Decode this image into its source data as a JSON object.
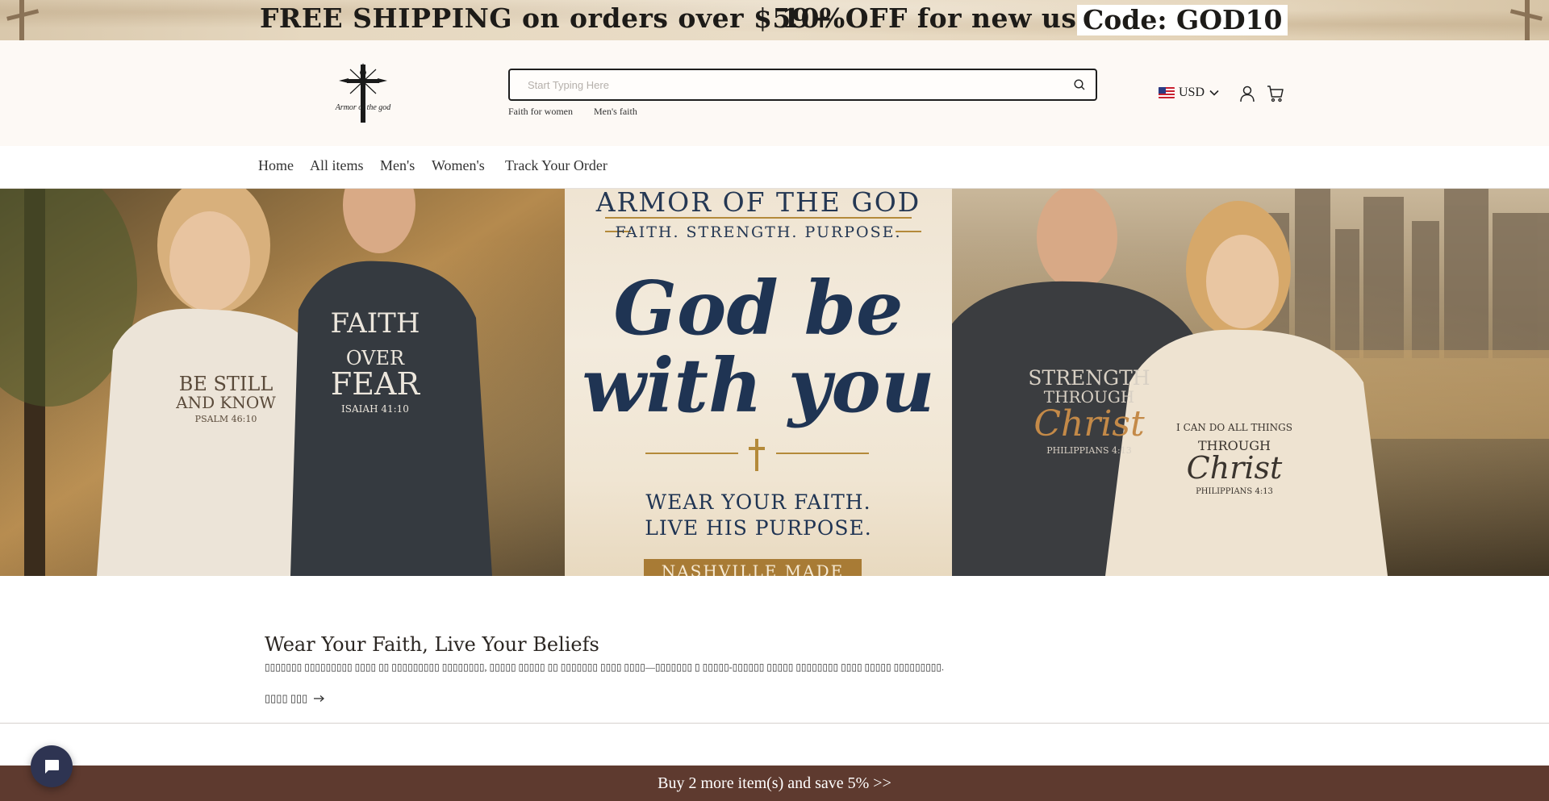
{
  "announcement": {
    "shipping": "FREE SHIPPING on orders over $59+",
    "discount": "10%OFF for new users",
    "code": "Code: GOD10"
  },
  "header": {
    "logo_text": "Armor of the god",
    "search": {
      "placeholder": "Start Typing Here",
      "value": ""
    },
    "suggestions": [
      "Faith for women",
      "Men's faith"
    ],
    "currency": "USD"
  },
  "nav": {
    "items": [
      "Home",
      "All items",
      "Men's",
      "Women's",
      "Track Your Order"
    ]
  },
  "hero": {
    "brand": "ARMOR OF THE GOD",
    "tagline": "FAITH. STRENGTH. PURPOSE.",
    "headline_line1": "God be",
    "headline_line2": "with you",
    "sub_line1": "WEAR YOUR FAITH.",
    "sub_line2": "LIVE HIS PURPOSE.",
    "badge": "NASHVILLE MADE",
    "shirt1": [
      "BE STILL",
      "AND KNOW",
      "PSALM 46:10"
    ],
    "shirt2": [
      "FAITH",
      "OVER",
      "FEAR",
      "ISAIAH 41:10"
    ],
    "shirt3": [
      "STRENGTH",
      "THROUGH",
      "Christ",
      "PHILIPPIANS 4:13"
    ],
    "shirt4": [
      "I CAN DO ALL THINGS",
      "THROUGH",
      "Christ",
      "PHILIPPIANS 4:13"
    ]
  },
  "section": {
    "title": "Wear Your Faith, Live Your Beliefs",
    "description": "▯▯▯▯▯▯▯ ▯▯▯▯▯▯▯▯▯ ▯▯▯▯ ▯▯ ▯▯▯▯▯▯▯▯▯ ▯▯▯▯▯▯▯▯, ▯▯▯▯▯ ▯▯▯▯▯ ▯▯ ▯▯▯▯▯▯▯ ▯▯▯▯ ▯▯▯▯—▯▯▯▯▯▯▯ ▯ ▯▯▯▯▯-▯▯▯▯▯▯ ▯▯▯▯▯ ▯▯▯▯▯▯▯▯ ▯▯▯▯ ▯▯▯▯▯ ▯▯▯▯▯▯▯▯▯.",
    "link_label": "▯▯▯▯ ▯▯▯"
  },
  "promo_bar": {
    "text": "Buy 2 more item(s) and save 5%  >>"
  },
  "colors": {
    "promo_bar": "#5e3a2f",
    "hero_navy": "#1f3453",
    "hero_gold": "#b48a3a",
    "chat_button": "#2e3452"
  },
  "icons": [
    "search-icon",
    "flag-us-icon",
    "chevron-down-icon",
    "account-icon",
    "cart-icon",
    "arrow-right-icon",
    "chat-icon",
    "cross-icon"
  ]
}
